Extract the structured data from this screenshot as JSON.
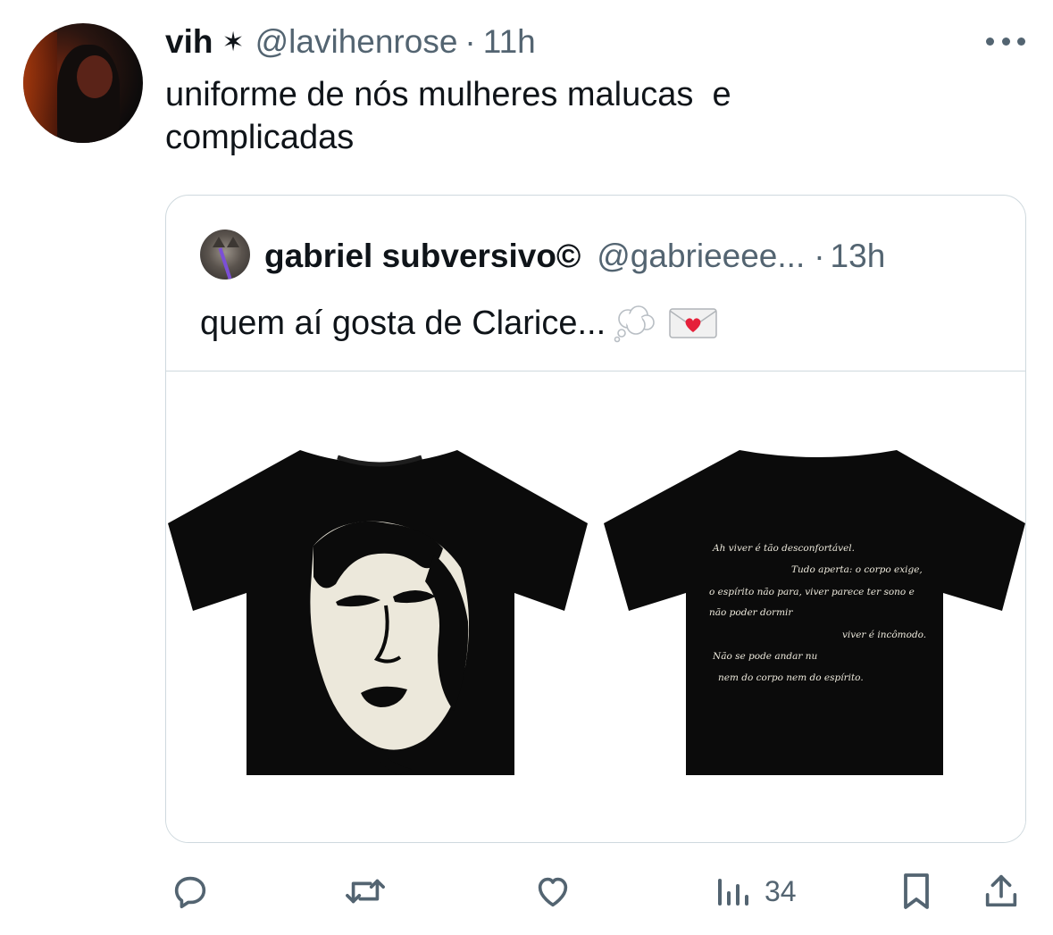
{
  "tweet": {
    "author_name": "vih",
    "author_badge": "✶",
    "handle": "@lavihenrose",
    "separator": "·",
    "time": "11h",
    "text_line1": "uniforme de nós mulheres malucas  e",
    "text_line2": "complicadas",
    "more_icon": "more-horizontal-icon"
  },
  "quoted": {
    "author_name": "gabriel subversivo©",
    "handle": "@gabrieeee...",
    "separator": "·",
    "time": "13h",
    "text": "quem aí gosta de Clarice...",
    "emojis": [
      "thought-balloon-emoji",
      "love-letter-emoji"
    ],
    "media": {
      "front_shirt": "black t-shirt with woman portrait print",
      "back_shirt_lines": [
        "Ah viver é tão desconfortável.",
        "Tudo aperta: o corpo exige,",
        "o espírito não para, viver parece ter sono e",
        "não poder dormir",
        "viver é incômodo.",
        "Não se pode andar nu",
        "nem do corpo nem do espírito."
      ]
    }
  },
  "actions": {
    "reply_icon": "reply-icon",
    "retweet_icon": "retweet-icon",
    "like_icon": "heart-icon",
    "views_icon": "analytics-icon",
    "views_count": "34",
    "bookmark_icon": "bookmark-icon",
    "share_icon": "share-icon"
  },
  "colors": {
    "text_primary": "#0f1419",
    "text_secondary": "#536471",
    "border": "#cfd9de",
    "shirt": "#0b0b0b",
    "print": "#ece8db"
  }
}
